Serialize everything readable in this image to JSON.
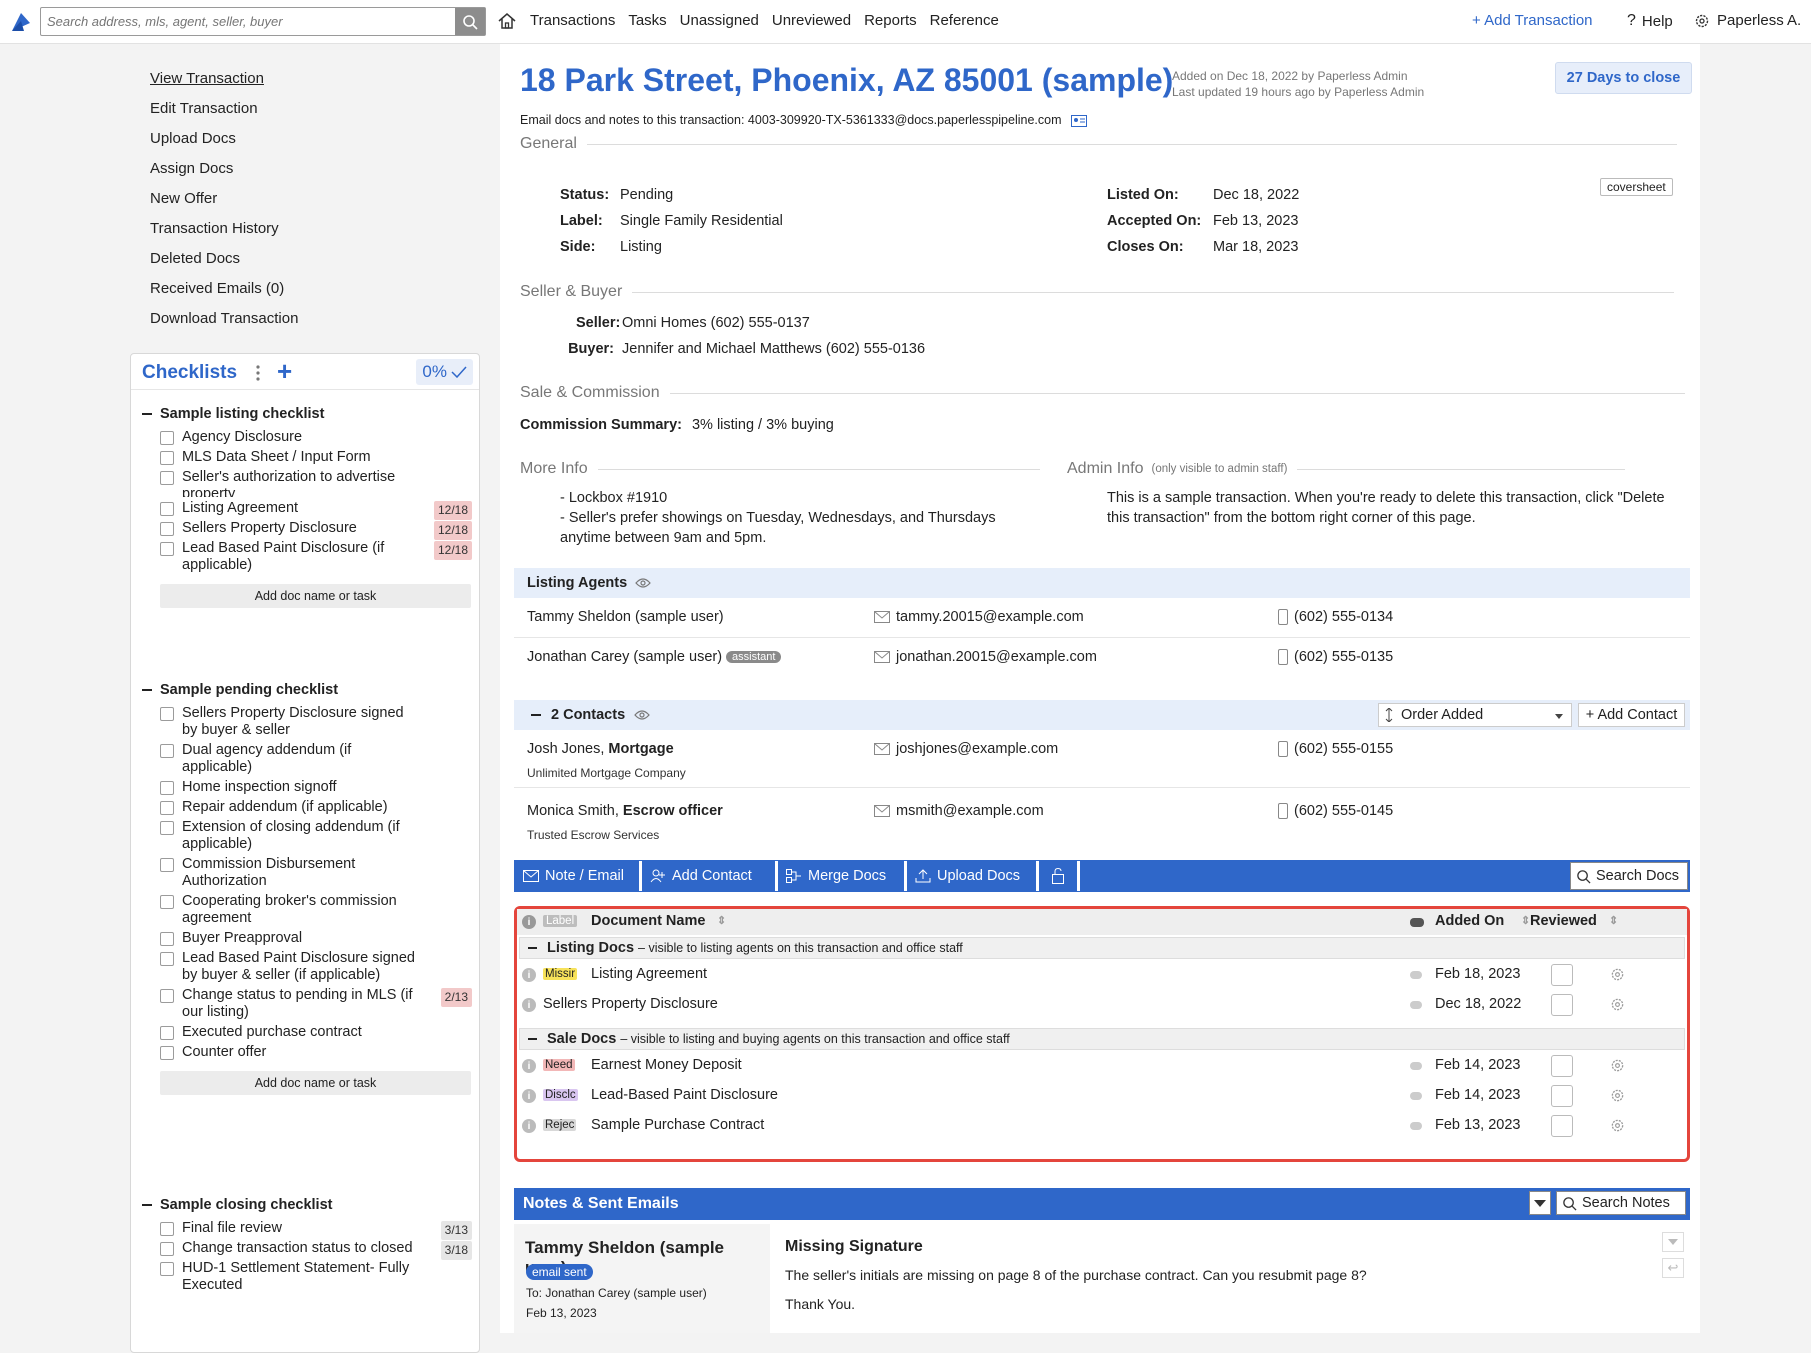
{
  "topbar": {
    "search_placeholder": "Search address, mls, agent, seller, buyer",
    "nav": [
      "Transactions",
      "Tasks",
      "Unassigned",
      "Unreviewed",
      "Reports",
      "Reference"
    ],
    "add_transaction": "+ Add Transaction",
    "help": "Help",
    "user": "Paperless A."
  },
  "sidebar": {
    "links": [
      "View Transaction",
      "Edit Transaction",
      "Upload Docs",
      "Assign Docs",
      "New Offer",
      "Transaction History",
      "Deleted Docs",
      "Received Emails (0)",
      "Download Transaction"
    ]
  },
  "checklists": {
    "title": "Checklists",
    "percent": "0%",
    "add_doc_label": "Add doc name or task",
    "lists": [
      {
        "title": "Sample listing checklist",
        "items": [
          {
            "text": "Agency Disclosure",
            "due": ""
          },
          {
            "text": "MLS Data Sheet / Input Form",
            "due": ""
          },
          {
            "text": "Seller's authorization to advertise property",
            "due": ""
          },
          {
            "text": "Listing Agreement",
            "due": "12/18"
          },
          {
            "text": "Sellers Property Disclosure",
            "due": "12/18"
          },
          {
            "text": "Lead Based Paint Disclosure (if applicable)",
            "due": "12/18"
          }
        ]
      },
      {
        "title": "Sample pending checklist",
        "items": [
          {
            "text": "Sellers Property Disclosure signed by buyer & seller",
            "due": ""
          },
          {
            "text": "Dual agency addendum (if applicable)",
            "due": ""
          },
          {
            "text": "Home inspection signoff",
            "due": ""
          },
          {
            "text": "Repair addendum (if applicable)",
            "due": ""
          },
          {
            "text": "Extension of closing addendum (if applicable)",
            "due": ""
          },
          {
            "text": "Commission Disbursement Authorization",
            "due": ""
          },
          {
            "text": "Cooperating broker's commission agreement",
            "due": ""
          },
          {
            "text": "Buyer Preapproval",
            "due": ""
          },
          {
            "text": "Lead Based Paint Disclosure signed by buyer & seller (if applicable)",
            "due": ""
          },
          {
            "text": "Change status to pending in MLS (if our listing)",
            "due": "2/13"
          },
          {
            "text": "Executed purchase contract",
            "due": ""
          },
          {
            "text": "Counter offer",
            "due": ""
          }
        ]
      },
      {
        "title": "Sample closing checklist",
        "items": [
          {
            "text": "Final file review",
            "due": "3/13"
          },
          {
            "text": "Change transaction status to closed",
            "due": "3/18"
          },
          {
            "text": "HUD-1 Settlement Statement- Fully Executed",
            "due": ""
          }
        ]
      }
    ]
  },
  "header": {
    "title": "18 Park Street, Phoenix, AZ 85001 (sample)",
    "added": "Added on Dec 18, 2022 by Paperless Admin",
    "updated": "Last updated 19 hours ago by Paperless Admin",
    "days_to_close": "27 Days to close",
    "email_prefix": "Email docs and notes to this transaction:",
    "email": "4003-309920-TX-5361333@docs.paperlesspipeline.com"
  },
  "general": {
    "heading": "General",
    "coversheet": "coversheet",
    "status_label": "Status:",
    "status": "Pending",
    "label_label": "Label:",
    "label": "Single Family Residential",
    "side_label": "Side:",
    "side": "Listing",
    "listed_label": "Listed On:",
    "listed": "Dec 18, 2022",
    "accepted_label": "Accepted On:",
    "accepted": "Feb 13, 2023",
    "closes_label": "Closes On:",
    "closes": "Mar 18, 2023"
  },
  "seller_buyer": {
    "heading": "Seller & Buyer",
    "seller_label": "Seller:",
    "seller": "Omni Homes (602) 555-0137",
    "buyer_label": "Buyer:",
    "buyer": "Jennifer and Michael Matthews (602) 555-0136"
  },
  "commission": {
    "heading": "Sale & Commission",
    "label": "Commission Summary:",
    "value": "3% listing / 3% buying"
  },
  "more_info": {
    "heading": "More Info",
    "lines": [
      "- Lockbox #1910",
      "- Seller's prefer showings on Tuesday, Wednesdays, and Thursdays anytime between 9am and 5pm."
    ]
  },
  "admin_info": {
    "heading": "Admin Info",
    "note": "(only visible to admin staff)",
    "text": "This is a sample transaction. When you're ready to delete this transaction, click \"Delete this transaction\" from the bottom right corner of this page."
  },
  "listing_agents": {
    "heading": "Listing Agents",
    "rows": [
      {
        "name": "Tammy Sheldon (sample user)",
        "badge": "",
        "email": "tammy.20015@example.com",
        "phone": "(602) 555-0134"
      },
      {
        "name": "Jonathan Carey (sample user)",
        "badge": "assistant",
        "email": "jonathan.20015@example.com",
        "phone": "(602) 555-0135"
      }
    ]
  },
  "contacts": {
    "heading": "2 Contacts",
    "order": "Order Added",
    "add": "+ Add Contact",
    "rows": [
      {
        "name": "Josh Jones,",
        "role": "Mortgage",
        "company": "Unlimited Mortgage Company",
        "email": "joshjones@example.com",
        "phone": "(602) 555-0155"
      },
      {
        "name": "Monica Smith,",
        "role": "Escrow officer",
        "company": "Trusted Escrow Services",
        "email": "msmith@example.com",
        "phone": "(602) 555-0145"
      }
    ]
  },
  "toolbar": {
    "note_email": "Note / Email",
    "add_contact": "Add Contact",
    "merge_docs": "Merge Docs",
    "upload_docs": "Upload Docs",
    "search_docs": "Search Docs"
  },
  "documents": {
    "col_label": "Label",
    "col_name": "Document Name",
    "col_added": "Added On",
    "col_reviewed": "Reviewed",
    "groups": [
      {
        "title": "Listing Docs",
        "desc": "– visible to listing agents on this transaction and office staff",
        "rows": [
          {
            "label": "Missir",
            "label_color": "#f7e25a",
            "name": "Listing Agreement",
            "date": "Feb 18, 2023"
          },
          {
            "label": "",
            "label_color": "",
            "name": "Sellers Property Disclosure",
            "date": "Dec 18, 2022"
          }
        ]
      },
      {
        "title": "Sale Docs",
        "desc": "– visible to listing and buying agents on this transaction and office staff",
        "rows": [
          {
            "label": "Need",
            "label_color": "#f2b7b7",
            "name": "Earnest Money Deposit",
            "date": "Feb 14, 2023"
          },
          {
            "label": "Disclc",
            "label_color": "#d9c6f0",
            "name": "Lead-Based Paint Disclosure",
            "date": "Feb 14, 2023"
          },
          {
            "label": "Rejec",
            "label_color": "#d8d8d8",
            "name": "Sample Purchase Contract",
            "date": "Feb 13, 2023"
          }
        ]
      }
    ]
  },
  "notes": {
    "heading": "Notes & Sent Emails",
    "search": "Search Notes",
    "author": "Tammy Sheldon (sample user)",
    "badge": "email sent",
    "to": "To: Jonathan Carey (sample user)",
    "date": "Feb 13, 2023",
    "subject": "Missing Signature",
    "body": "The seller's initials are missing on page 8 of the purchase contract. Can you resubmit page 8?",
    "signoff": "Thank You."
  },
  "colors": {
    "accent": "#2f67c9",
    "highlight_border": "#e4453c"
  }
}
